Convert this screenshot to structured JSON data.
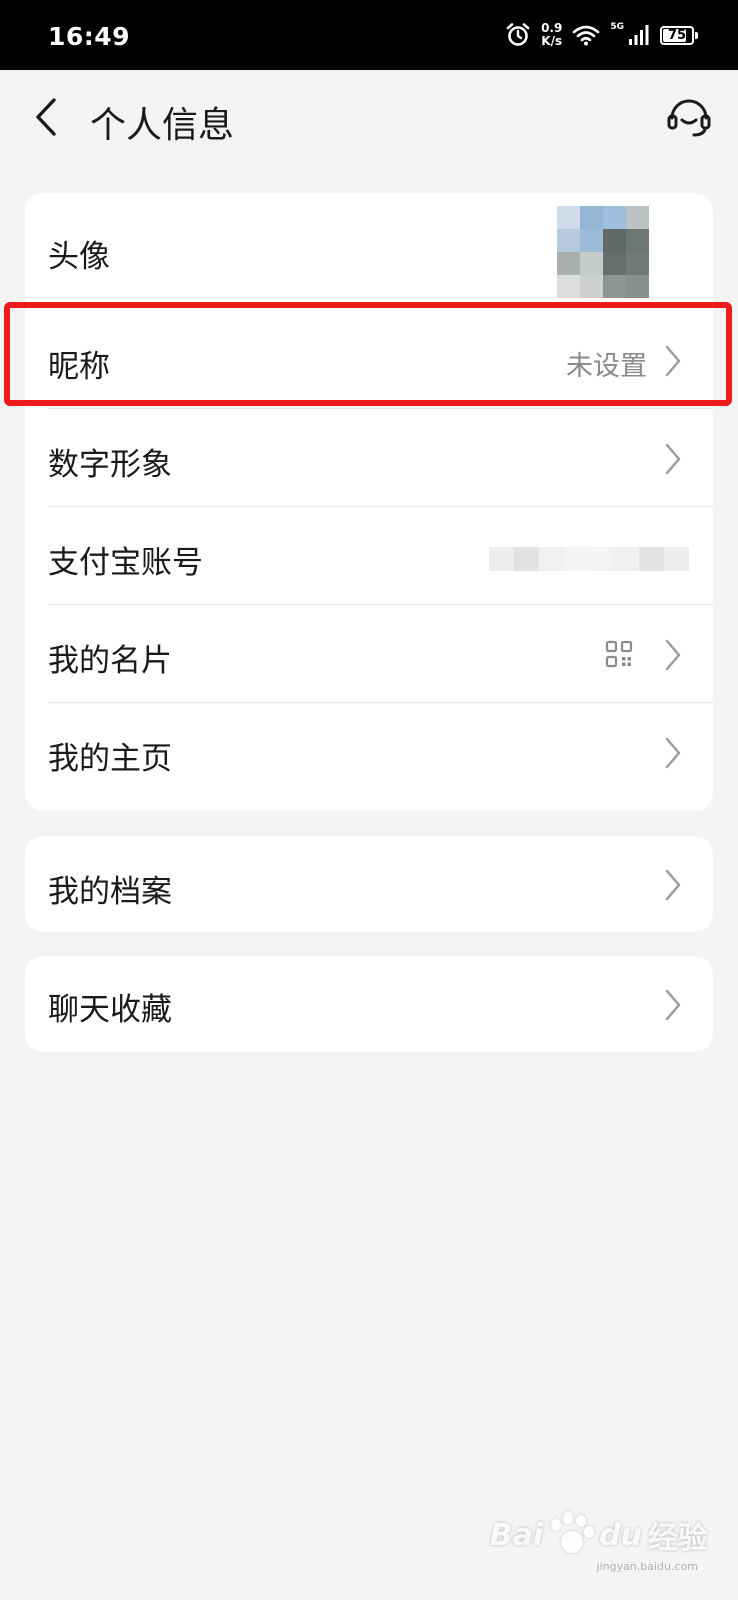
{
  "status_bar": {
    "time": "16:49",
    "net_speed_value": "0.9",
    "net_speed_unit": "K/s",
    "signal_label": "5G",
    "battery": "75"
  },
  "header": {
    "title": "个人信息"
  },
  "profile": {
    "items": [
      {
        "label": "头像"
      },
      {
        "label": "昵称",
        "value": "未设置"
      },
      {
        "label": "数字形象"
      },
      {
        "label": "支付宝账号"
      },
      {
        "label": "我的名片"
      },
      {
        "label": "我的主页"
      }
    ]
  },
  "archive": {
    "label": "我的档案"
  },
  "favorites": {
    "label": "聊天收藏"
  },
  "watermark": {
    "brand_left": "Bai",
    "brand_right": "du",
    "brand_cn": "经验",
    "sub": "jingyan.baidu.com"
  },
  "colors": {
    "background": "#f4f4f4",
    "highlight": "#ee1b1b"
  },
  "icons": [
    "back-arrow-icon",
    "customer-service-icon",
    "alarm-icon",
    "wifi-icon",
    "signal-icon",
    "battery-icon",
    "chevron-right-icon",
    "qr-code-icon"
  ]
}
